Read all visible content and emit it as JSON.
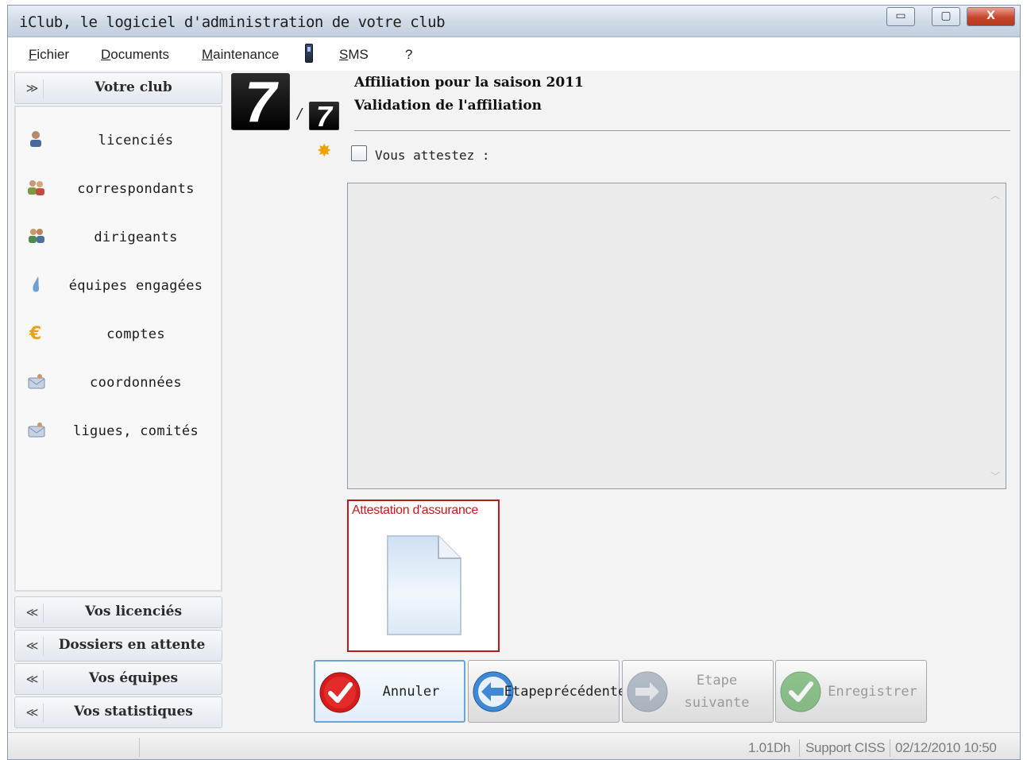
{
  "window": {
    "title": "iClub, le logiciel d'administration de votre club",
    "minimize_glyph": "▭",
    "maximize_glyph": "▢",
    "close_glyph": "X"
  },
  "menu": {
    "fichier_underline": "F",
    "fichier_rest": "ichier",
    "documents_underline": "D",
    "documents_rest": "ocuments",
    "maintenance_underline": "M",
    "maintenance_rest": "aintenance",
    "sms_underline": "S",
    "sms_rest": "MS",
    "help": "?"
  },
  "sidebar": {
    "top_section": {
      "label": "Votre club",
      "chevron": "≫"
    },
    "items": [
      {
        "label": "licenciés",
        "icon": "person-icon"
      },
      {
        "label": "correspondants",
        "icon": "people-icon"
      },
      {
        "label": "dirigeants",
        "icon": "group-icon"
      },
      {
        "label": "équipes engagées",
        "icon": "drop-icon"
      },
      {
        "label": "comptes",
        "icon": "euro-icon"
      },
      {
        "label": "coordonnées",
        "icon": "envelope-icon"
      },
      {
        "label": "ligues, comités",
        "icon": "envelope-icon"
      }
    ],
    "bottom_sections": [
      {
        "label": "Vos licenciés",
        "chevron": "≪"
      },
      {
        "label": "Dossiers en attente",
        "chevron": "≪"
      },
      {
        "label": "Vos équipes",
        "chevron": "≪"
      },
      {
        "label": "Vos statistiques",
        "chevron": "≪"
      }
    ]
  },
  "wizard": {
    "current_step": "7",
    "total_steps": "7",
    "separator": "/",
    "title": "Affiliation pour la saison 2011",
    "subtitle": "Validation de l'affiliation",
    "attest_label": "Vous attestez :",
    "attest_checked": false,
    "textarea_value": "",
    "scroll_up": "︿",
    "scroll_down": "﹀",
    "assurance_label": "Attestation d'assurance"
  },
  "buttons": {
    "annuler": "Annuler",
    "prev_line1": "Etape",
    "prev_line2": "précédente",
    "next": "Etape suivante",
    "save": "Enregistrer"
  },
  "statusbar": {
    "version": "1.01Dh",
    "support": "Support CISS",
    "datetime": "02/12/2010 10:50"
  },
  "colors": {
    "accent_red": "#c81818",
    "primary_border": "#6ea3d6",
    "disabled_text": "#9a9a9a"
  }
}
